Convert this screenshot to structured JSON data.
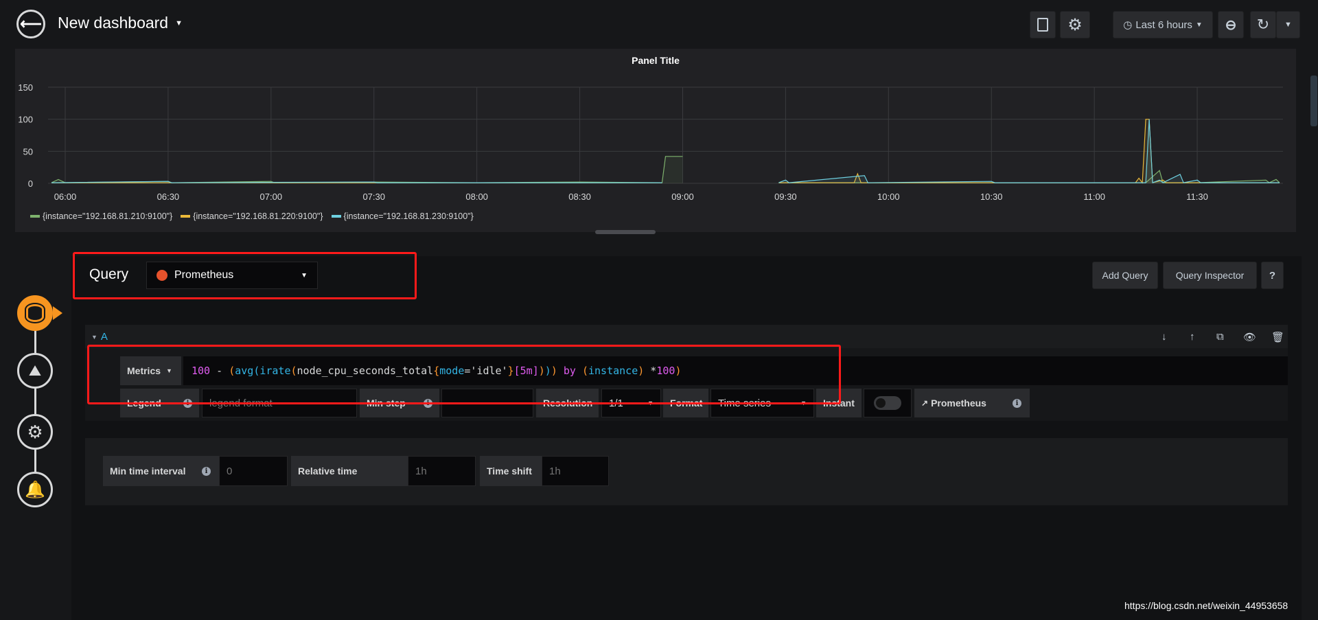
{
  "header": {
    "title": "New dashboard",
    "time_range": "Last 6 hours"
  },
  "panel": {
    "title": "Panel Title"
  },
  "chart_data": {
    "type": "line",
    "title": "Panel Title",
    "x_range": [
      "05:55",
      "11:55"
    ],
    "ylim": [
      0,
      150
    ],
    "yticks": [
      "150",
      "100",
      "50",
      "0"
    ],
    "ytick_values": [
      150,
      100,
      50,
      0
    ],
    "xticks": [
      "06:00",
      "06:30",
      "07:00",
      "07:30",
      "08:00",
      "08:30",
      "09:00",
      "09:30",
      "10:00",
      "10:30",
      "11:00",
      "11:30"
    ],
    "grid": true,
    "legend_placement": "bottom-left",
    "series": [
      {
        "name": "{instance=\"192.168.81.210:9100\"}",
        "color": "#7eb26d",
        "points": [
          [
            "05:56",
            1
          ],
          [
            "05:58",
            6
          ],
          [
            "06:00",
            1
          ],
          [
            "06:30",
            3
          ],
          [
            "06:31",
            1
          ],
          [
            "07:00",
            3
          ],
          [
            "07:01",
            1
          ],
          [
            "07:30",
            2
          ],
          [
            "08:00",
            1
          ],
          [
            "08:30",
            2
          ],
          [
            "08:54",
            1
          ],
          [
            "08:55",
            42
          ],
          [
            "09:00",
            42
          ],
          [
            "09:00",
            null
          ],
          [
            "09:28",
            1
          ],
          [
            "10:00",
            1
          ],
          [
            "10:30",
            1
          ],
          [
            "11:00",
            1
          ],
          [
            "11:15",
            1
          ],
          [
            "11:19",
            20
          ],
          [
            "11:20",
            1
          ],
          [
            "11:30",
            1
          ],
          [
            "11:50",
            5
          ],
          [
            "11:51",
            1
          ],
          [
            "11:53",
            6
          ],
          [
            "11:54",
            1
          ]
        ]
      },
      {
        "name": "{instance=\"192.168.81.220:9100\"}",
        "color": "#eab839",
        "points": [
          [
            "05:56",
            1
          ],
          [
            "08:54",
            1
          ],
          [
            "08:54",
            null
          ],
          [
            "09:28",
            1
          ],
          [
            "09:50",
            1
          ],
          [
            "09:51",
            15
          ],
          [
            "09:52",
            1
          ],
          [
            "11:12",
            1
          ],
          [
            "11:13",
            8
          ],
          [
            "11:14",
            1
          ],
          [
            "11:15",
            100
          ],
          [
            "11:16",
            100
          ],
          [
            "11:17",
            1
          ],
          [
            "11:20",
            5
          ],
          [
            "11:21",
            1
          ],
          [
            "11:54",
            1
          ]
        ]
      },
      {
        "name": "{instance=\"192.168.81.230:9100\"}",
        "color": "#6ed0e0",
        "points": [
          [
            "05:56",
            1
          ],
          [
            "06:30",
            3
          ],
          [
            "06:31",
            1
          ],
          [
            "07:30",
            2
          ],
          [
            "07:31",
            1
          ],
          [
            "08:54",
            1
          ],
          [
            "08:54",
            null
          ],
          [
            "09:28",
            1
          ],
          [
            "09:30",
            5
          ],
          [
            "09:31",
            1
          ],
          [
            "09:53",
            12
          ],
          [
            "09:54",
            1
          ],
          [
            "10:30",
            3
          ],
          [
            "10:31",
            1
          ],
          [
            "11:15",
            1
          ],
          [
            "11:16",
            100
          ],
          [
            "11:17",
            1
          ],
          [
            "11:19",
            5
          ],
          [
            "11:20",
            1
          ],
          [
            "11:25",
            14
          ],
          [
            "11:26",
            1
          ],
          [
            "11:30",
            5
          ],
          [
            "11:31",
            1
          ],
          [
            "11:54",
            1
          ]
        ]
      }
    ]
  },
  "query": {
    "label": "Query",
    "datasource": "Prometheus",
    "add_query": "Add Query",
    "inspector": "Query Inspector",
    "help": "?"
  },
  "row": {
    "ref_id": "A",
    "metrics_label": "Metrics",
    "expr_tokens": [
      {
        "t": "100",
        "c": "#e05cf0"
      },
      {
        "t": " - ",
        "c": "#d8d9da"
      },
      {
        "t": "(",
        "c": "#ff9830"
      },
      {
        "t": "avg",
        "c": "#33b5e5"
      },
      {
        "t": "(",
        "c": "#33b5e5"
      },
      {
        "t": "irate",
        "c": "#33b5e5"
      },
      {
        "t": "(",
        "c": "#ff9830"
      },
      {
        "t": "node_cpu_seconds_total",
        "c": "#d8d9da"
      },
      {
        "t": "{",
        "c": "#ff9830"
      },
      {
        "t": "mode",
        "c": "#33b5e5"
      },
      {
        "t": "=",
        "c": "#d8d9da"
      },
      {
        "t": "'idle'",
        "c": "#d8d9da"
      },
      {
        "t": "}",
        "c": "#ff9830"
      },
      {
        "t": "[",
        "c": "#e05cf0"
      },
      {
        "t": "5m",
        "c": "#e05cf0"
      },
      {
        "t": "]",
        "c": "#e05cf0"
      },
      {
        "t": ")",
        "c": "#ff9830"
      },
      {
        "t": ")",
        "c": "#33b5e5"
      },
      {
        "t": ")",
        "c": "#ff9830"
      },
      {
        "t": " by ",
        "c": "#e05cf0"
      },
      {
        "t": "(",
        "c": "#ff9830"
      },
      {
        "t": "instance",
        "c": "#33b5e5"
      },
      {
        "t": ")",
        "c": "#ff9830"
      },
      {
        "t": " *",
        "c": "#d8d9da"
      },
      {
        "t": "100",
        "c": "#e05cf0"
      },
      {
        "t": ")",
        "c": "#ff9830"
      }
    ],
    "legend_label": "Legend",
    "legend_placeholder": "legend format",
    "min_step_label": "Min step",
    "resolution_label": "Resolution",
    "resolution_value": "1/1",
    "format_label": "Format",
    "format_value": "Time series",
    "instant_label": "Instant",
    "instant_on": false,
    "link_label": "Prometheus"
  },
  "options": {
    "min_interval_label": "Min time interval",
    "min_interval_placeholder": "0",
    "relative_label": "Relative time",
    "relative_placeholder": "1h",
    "shift_label": "Time shift",
    "shift_placeholder": "1h"
  },
  "watermark": "https://blog.csdn.net/weixin_44953658"
}
